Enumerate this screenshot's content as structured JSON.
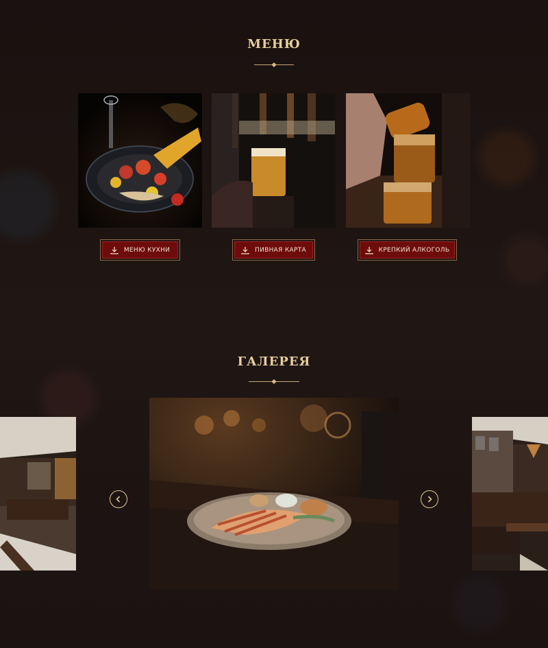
{
  "menu_section": {
    "title": "МЕНЮ",
    "photos": [
      {
        "icon": "food-photo"
      },
      {
        "icon": "beer-tap-photo"
      },
      {
        "icon": "whiskey-pour-photo"
      }
    ],
    "buttons": [
      {
        "label": "МЕНЮ КУХНИ",
        "icon": "download-icon"
      },
      {
        "label": "ПИВНАЯ КАРТА",
        "icon": "download-icon"
      },
      {
        "label": "КРЕПКИЙ АЛКОГОЛЬ",
        "icon": "download-icon"
      }
    ]
  },
  "gallery_section": {
    "title": "ГАЛЕРЕЯ",
    "prev_icon": "chevron-left-icon",
    "next_icon": "chevron-right-icon"
  },
  "colors": {
    "background": "#1c1412",
    "accent_gold": "#e6c99a",
    "button_red": "#6e0c0c"
  }
}
